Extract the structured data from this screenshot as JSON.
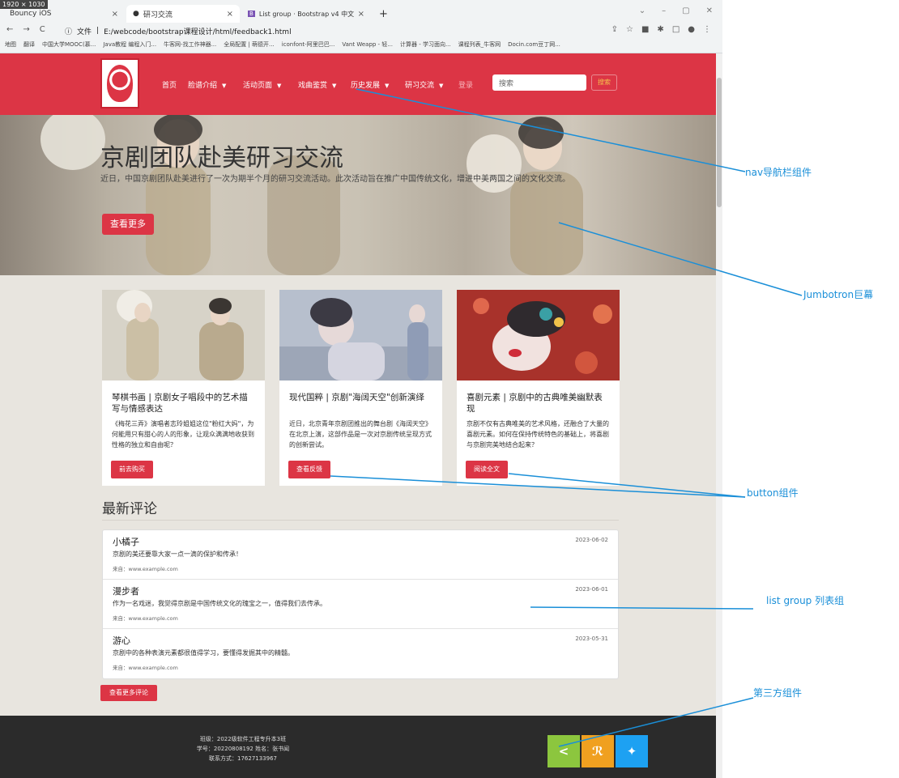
{
  "browser": {
    "dim_badge": "1920 × 1030",
    "tabs": [
      {
        "title": "Bouncy iOS",
        "close": "×"
      },
      {
        "title": "研习交流",
        "close": "×"
      },
      {
        "title": "List group · Bootstrap v4 中文",
        "close": "×"
      }
    ],
    "new_tab": "+",
    "address_prefix": "文件",
    "address": "E:/webcode/bootstrap课程设计/html/feedback1.html",
    "bookmarks": [
      "地图",
      "翻译",
      "中国大学MOOC(慕...",
      "Java教程 编程入门...",
      "牛客网-找工作神器...",
      "全局配置 | 萌德开...",
      "iconfont-阿里巴巴...",
      "Vant Weapp - 轻...",
      "计算器 - 学习面向...",
      "课程列表_牛客网",
      "Docin.com豆丁网..."
    ]
  },
  "navbar": {
    "links": [
      "首页",
      "脸谱介绍",
      "活动页面",
      "戏曲鉴赏",
      "历史发展",
      "研习交流"
    ],
    "login": "登录",
    "search_placeholder": "搜索",
    "search_button": "搜索"
  },
  "jumbotron": {
    "title": "京剧团队赴美研习交流",
    "text": "近日，中国京剧团队赴美进行了一次为期半个月的研习交流活动。此次活动旨在推广中国传统文化，增进中美两国之间的文化交流。",
    "button": "查看更多"
  },
  "cards": [
    {
      "title": "琴棋书画 | 京剧女子唱段中的艺术描写与情感表达",
      "text": "《梅花三弄》演唱者志玲姐姐这位\"粉红大妈\"，为何能用只有甜心的人的形象，让观众满满地收获到性格的独立和自由呢？",
      "button": "前去购买"
    },
    {
      "title": "现代国粹 | 京剧\"海阔天空\"创新演绎",
      "text": "近日，北京青年京剧团推出的舞台剧《海阔天空》在北京上演，这部作品是一次对京剧传统呈现方式的创新尝试。",
      "button": "查看反馈"
    },
    {
      "title": "喜剧元素 | 京剧中的古典唯美幽默表现",
      "text": "京剧不仅有古典唯美的艺术风格，还融合了大量的喜剧元素。如何在保持传统特色的基础上，将喜剧与京剧完美地结合起来？",
      "button": "阅读全文"
    }
  ],
  "comments": {
    "heading": "最新评论",
    "items": [
      {
        "name": "小橘子",
        "date": "2023-06-02",
        "text": "京剧的美还要靠大家一点一滴的保护和传承！",
        "source": "来自：www.example.com"
      },
      {
        "name": "漫步者",
        "date": "2023-06-01",
        "text": "作为一名戏迷，我觉得京剧是中国传统文化的瑰宝之一，值得我们去传承。",
        "source": "来自：www.example.com"
      },
      {
        "name": "游心",
        "date": "2023-05-31",
        "text": "京剧中的各种表演元素都很值得学习，要懂得发掘其中的精髓。",
        "source": "来自：www.example.com"
      }
    ],
    "more_button": "查看更多评论"
  },
  "footer": {
    "lines": [
      "班级：2022级软件工程专升本3班",
      "学号：20220808192 姓名：张书闻",
      "联系方式：17627133967"
    ]
  },
  "social": [
    {
      "icon": "share-icon",
      "glyph": "<",
      "color": "#8cc63e"
    },
    {
      "icon": "rss-icon",
      "glyph": "ℕ",
      "color": "#f0a020"
    },
    {
      "icon": "twitter-icon",
      "glyph": "✦",
      "color": "#1da1f2"
    }
  ],
  "annotations": [
    "nav导航栏组件",
    "Jumbotron巨幕",
    "button组件",
    "list group 列表组",
    "第三方组件"
  ],
  "colors": {
    "primary": "#dc3545",
    "annotation": "#1a8fd8",
    "footer": "#2b2b2b"
  }
}
